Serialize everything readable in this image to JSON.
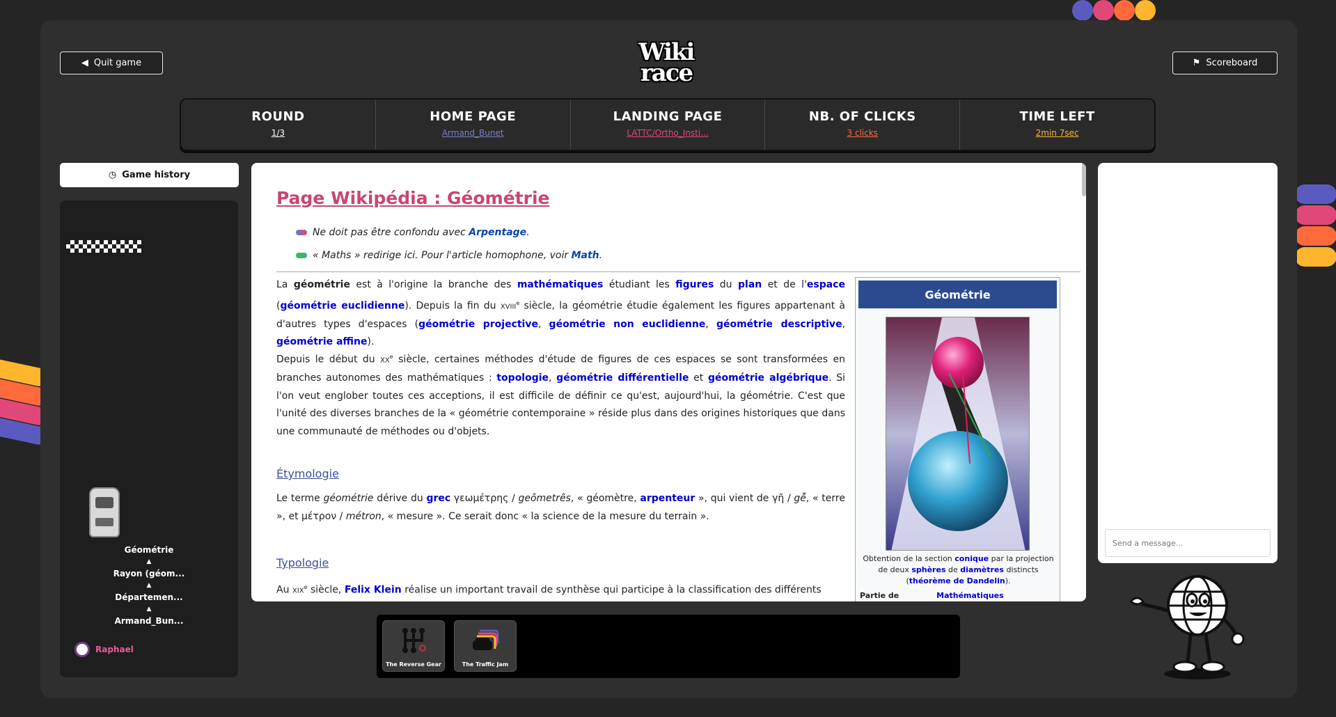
{
  "header": {
    "quit_label": "Quit game",
    "scoreboard_label": "Scoreboard",
    "logo_top": "Wiki",
    "logo_bottom": "race"
  },
  "stats": [
    {
      "title": "ROUND",
      "value": "1/3",
      "color": "#ffffff"
    },
    {
      "title": "HOME PAGE",
      "value": "Armand_Bunet",
      "color": "#7b7fc4"
    },
    {
      "title": "LANDING PAGE",
      "value": "LATTC/Ortho_Insti...",
      "color": "#e0487a"
    },
    {
      "title": "NB. OF CLICKS",
      "value": "3 clicks",
      "color": "#ff6a3d"
    },
    {
      "title": "TIME LEFT",
      "value": "2min 7sec",
      "color": "#ffb52e"
    }
  ],
  "sidebar": {
    "history_label": "Game history",
    "path": [
      "Géométrie",
      "Rayon (géom...",
      "Départemen...",
      "Armand_Bun..."
    ],
    "arrow": "▲",
    "player_name": "Raphael"
  },
  "article": {
    "title": "Page Wikipédia : Géométrie",
    "hatnote1_text": "Ne doit pas être confondu avec",
    "hatnote1_link": "Arpentage",
    "hatnote1_end": ".",
    "hatnote2_text": "« Maths » redirige ici. Pour l'article homophone, voir",
    "hatnote2_link": "Math",
    "hatnote2_end": ".",
    "p1": {
      "a": "La",
      "b": "géométrie",
      "c": "est à l'origine la branche des",
      "d": "mathématiques",
      "e": "étudiant les",
      "f": "figures",
      "g": "du",
      "h": "plan",
      "i": "et de l'",
      "j": "espace",
      "k": "(",
      "l": "géométrie euclidienne",
      "m": "). Depuis la fin du",
      "n": "XVIII",
      "o": "e",
      "p": "siècle, la géométrie étudie également les figures appartenant à d'autres types d'espaces (",
      "q": "géométrie projective",
      "r": ",",
      "s": "géométrie non euclidienne",
      "t": ",",
      "u": "géométrie descriptive",
      "v": ",",
      "w": "géométrie affine",
      "x": ")."
    },
    "p2": {
      "a": "Depuis le début du",
      "b": "XX",
      "c": "e",
      "d": "siècle, certaines méthodes d'étude de figures de ces espaces se sont transformées en branches autonomes des mathématiques :",
      "e": "topologie",
      "f": ",",
      "g": "géométrie différentielle",
      "h": "et",
      "i": "géométrie algébrique",
      "j": ". Si l'on veut englober toutes ces acceptions, il est difficile de définir ce qu'est, aujourd'hui, la géométrie. C'est que l'unité des diverses branches de la « géométrie contemporaine » réside plus dans des origines historiques que dans une communauté de méthodes ou d'objets."
    },
    "section1": "Étymologie",
    "p3": {
      "a": "Le terme",
      "b": "géométrie",
      "c": "dérive du",
      "d": "grec",
      "e": "γεωμέτρης /",
      "f": "geômetrês",
      "g": ", « géomètre,",
      "h": "arpenteur",
      "i": "», qui vient de γῆ /",
      "j": "gễ",
      "k": ", « terre », et μέτρον /",
      "l": "métron",
      "m": ", « mesure ». Ce serait donc « la science de la mesure du terrain »."
    },
    "section2": "Typologie",
    "p4": {
      "a": "Au",
      "b": "XIX",
      "c": "e",
      "d": "siècle,",
      "e": "Felix Klein",
      "f": "réalise un important travail de synthèse qui participe à la classification des différents"
    },
    "infobox": {
      "title": "Géométrie",
      "cap_a": "Obtention de la section",
      "cap_b": "conique",
      "cap_c": "par la projection de deux",
      "cap_d": "sphères",
      "cap_e": "de",
      "cap_f": "diamètres",
      "cap_g": "distincts (",
      "cap_h": "théorème de Dandelin",
      "cap_i": ").",
      "row_label": "Partie de",
      "row_value": "Mathématiques"
    }
  },
  "chat": {
    "placeholder": "Send a message..."
  },
  "powers": [
    {
      "label": "The Reverse Gear",
      "icon": "gear-shift-icon"
    },
    {
      "label": "The Traffic Jam",
      "icon": "traffic-jam-icon"
    }
  ],
  "colors": {
    "accent_pink": "#c94575",
    "link_blue": "#0000cc",
    "infobox_header": "#2b4b8e"
  }
}
